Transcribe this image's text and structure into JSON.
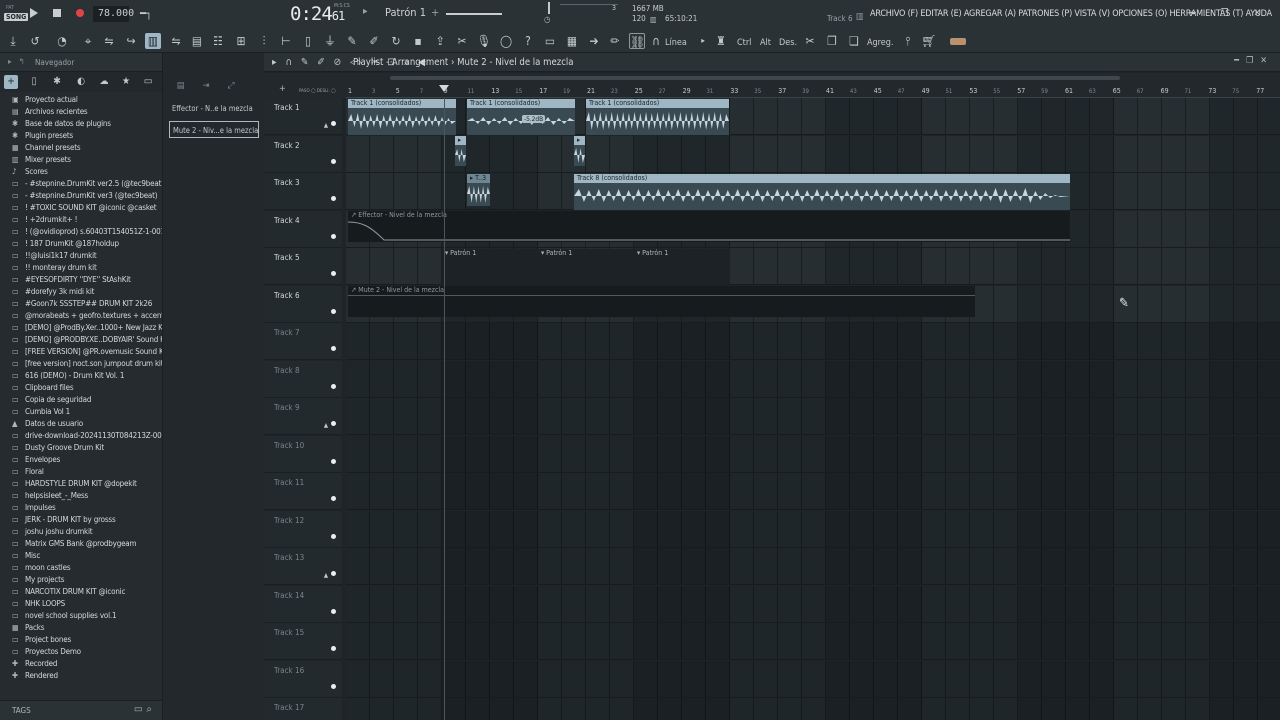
{
  "topbar": {
    "pat_label": "PAT",
    "song_label": "SONG",
    "tempo": "78.000",
    "time": "0:24",
    "time_frac": "61",
    "time_unit": "M:S:CS",
    "pattern": "Patrón 1",
    "plus": "+",
    "cpu_num": "3",
    "memory": "1667 MB",
    "polyphony": "120",
    "clock": "65:10:21",
    "track_hint": "Track 6",
    "menu": "ARCHIVO (F) EDITAR (E) AGREGAR (A) PATRONES (P) VISTA (V) OPCIONES (O) HERRAMIENTAS (T) AYUDA",
    "window_buttons": "━ ❐ ✕"
  },
  "toolbar": {
    "line_label": "Línea",
    "ctrl_label": "Ctrl",
    "alt_label": "Alt",
    "des_label": "Des.",
    "agreg_label": "Agreg."
  },
  "browser": {
    "title": "Navegador",
    "tags_label": "TAGS",
    "items": [
      {
        "icon": "▣",
        "label": "Proyecto actual"
      },
      {
        "icon": "▤",
        "label": "Archivos recientes"
      },
      {
        "icon": "✱",
        "label": "Base de datos de plugins"
      },
      {
        "icon": "✱",
        "label": "Plugin presets"
      },
      {
        "icon": "▦",
        "label": "Channel presets"
      },
      {
        "icon": "▥",
        "label": "Mixer presets"
      },
      {
        "icon": "♪",
        "label": "Scores"
      },
      {
        "icon": "▭",
        "label": "- #stepnine.DrumKit ver2.5 (@tec9beat)"
      },
      {
        "icon": "▭",
        "label": "- #stepnine.DrumKit ver3 (@tec9beat)"
      },
      {
        "icon": "▭",
        "label": "! #TOXIC SOUND KIT @iconic @casket"
      },
      {
        "icon": "▭",
        "label": "!  +2drumkit+ !"
      },
      {
        "icon": "▭",
        "label": "! (@ovidioprod) s.60403T154051Z-1-001"
      },
      {
        "icon": "▭",
        "label": "! 187 DrumKit @187holdup"
      },
      {
        "icon": "▭",
        "label": "!!@luisi1k17 drumkit"
      },
      {
        "icon": "▭",
        "label": "!! monteray drum kit"
      },
      {
        "icon": "▭",
        "label": "#EYESOFDIRTY ''DYE'' StAshKit"
      },
      {
        "icon": "▭",
        "label": "#dorefyy 3k midi kit"
      },
      {
        "icon": "▭",
        "label": "#Goon7k SSSTEP## DRUM KIT 2k26"
      },
      {
        "icon": "▭",
        "label": "@morabeats + geofro.textures + accents)"
      },
      {
        "icon": "▭",
        "label": "[DEMO] @ProdBy.Xer..1000+ New Jazz Kit"
      },
      {
        "icon": "▭",
        "label": "[DEMO] @PRODBY.XE..DOBYAIR' Sound Kit"
      },
      {
        "icon": "▭",
        "label": "[FREE VERSION] @PR.ovemusic Sound Kit"
      },
      {
        "icon": "▭",
        "label": "[free version] noct.son jumpout drum kit"
      },
      {
        "icon": "▭",
        "label": "616 (DEMO) -  Drum Kit Vol. 1"
      },
      {
        "icon": "▭",
        "label": "Clipboard files"
      },
      {
        "icon": "▭",
        "label": "Copia de seguridad"
      },
      {
        "icon": "▭",
        "label": "Cumbia Vol 1"
      },
      {
        "icon": "▲",
        "label": "Datos de usuario"
      },
      {
        "icon": "▭",
        "label": "drive-download-20241130T084213Z-001"
      },
      {
        "icon": "▭",
        "label": "Dusty Groove Drum Kit"
      },
      {
        "icon": "▭",
        "label": "Envelopes"
      },
      {
        "icon": "▭",
        "label": "Floral"
      },
      {
        "icon": "▭",
        "label": "HARDSTYLE DRUM KIT @dopekit"
      },
      {
        "icon": "▭",
        "label": "helpsisleet_-_Mess"
      },
      {
        "icon": "▭",
        "label": "Impulses"
      },
      {
        "icon": "▭",
        "label": "JERK - DRUM KIT by grosss"
      },
      {
        "icon": "▭",
        "label": "joshu joshu drumkit"
      },
      {
        "icon": "▭",
        "label": "Matrix GMS Bank @prodbygeam"
      },
      {
        "icon": "▭",
        "label": "Misc"
      },
      {
        "icon": "▭",
        "label": "moon castles"
      },
      {
        "icon": "▭",
        "label": "My projects"
      },
      {
        "icon": "▭",
        "label": "NARCOTIX DRUM KIT @iconic"
      },
      {
        "icon": "▭",
        "label": "NHK LOOPS"
      },
      {
        "icon": "▭",
        "label": "novel school supplies vol.1"
      },
      {
        "icon": "▦",
        "label": "Packs"
      },
      {
        "icon": "▭",
        "label": "Project bones"
      },
      {
        "icon": "▭",
        "label": "Proyectos Demo"
      },
      {
        "icon": "✚",
        "label": "Recorded"
      },
      {
        "icon": "✚",
        "label": "Rendered"
      }
    ]
  },
  "picker": {
    "clips": [
      "Effector - N..e la mezcla",
      "Mute 2 - Niv...e la mezcla"
    ]
  },
  "playlist": {
    "title": "Playlist - Arrangement",
    "breadcrumb_sep": "›",
    "current": "Mute 2 - Nivel de la mezcla",
    "paso_label": "PASO",
    "desl_label": "DESLI.",
    "ruler_major": [
      "1",
      "5",
      "9",
      "13",
      "17",
      "21",
      "25",
      "29",
      "33",
      "37",
      "41",
      "45",
      "49",
      "53",
      "57",
      "61",
      "65",
      "69",
      "73",
      "77"
    ],
    "tracks": [
      "Track 1",
      "Track 2",
      "Track 3",
      "Track 4",
      "Track 5",
      "Track 6",
      "Track 7",
      "Track 8",
      "Track 9",
      "Track 10",
      "Track 11",
      "Track 12",
      "Track 13",
      "Track 14",
      "Track 15",
      "Track 16",
      "Track 17"
    ],
    "clips": {
      "t1a": "Track 1 (consolidados)",
      "t1b": "Track 1 (consolidados)",
      "t1c": "Track 1 (consolidados)",
      "t1_db": "-5.2dB",
      "t3b": "Track 8 (consolidados)",
      "t4": "Effector - Nivel de la mezcla",
      "t5a": "Patrón 1",
      "t5b": "Patrón 1",
      "t5c": "Patrón 1",
      "t6": "Mute 2 - Nivel de la mezcla"
    }
  },
  "colors": {
    "clip_header": "#9fb6c4",
    "waveform": "#c9d6dd",
    "record": "#e04545",
    "background": "#1e2428"
  }
}
